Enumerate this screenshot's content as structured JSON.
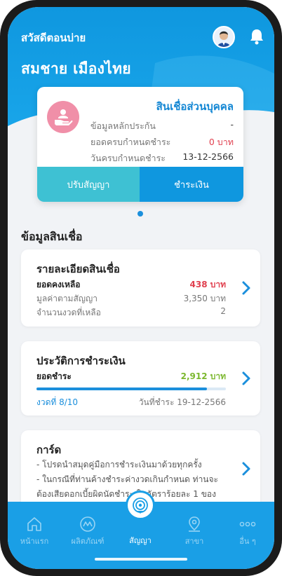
{
  "header": {
    "greeting": "สวัสดีตอนบ่าย",
    "user_name": "สมชาย เมืองไทย"
  },
  "loan_card": {
    "type": "สินเชื่อส่วนบุคคล",
    "rows": [
      {
        "label": "ข้อมูลหลักประกัน",
        "value": "-"
      },
      {
        "label": "ยอดครบกำหนดชำระ",
        "value": "0 บาท"
      },
      {
        "label": "วันครบกำหนดชำระ",
        "value": "13-12-2566"
      }
    ],
    "adjust_label": "ปรับสัญญา",
    "pay_label": "ชำระเงิน"
  },
  "section_title": "ข้อมูลสินเชื่อ",
  "loan_details": {
    "title": "รายละเอียดสินเชื่อ",
    "rows": [
      {
        "label": "ยอดคงเหลือ",
        "value": "438 บาท"
      },
      {
        "label": "มูลค่าตามสัญญา",
        "value": "3,350 บาท"
      },
      {
        "label": "จำนวนงวดที่เหลือ",
        "value": "2"
      }
    ]
  },
  "payment_history": {
    "title": "ประวัติการชำระเงิน",
    "paid_label": "ยอดชำระ",
    "paid_value": "2,912 บาท",
    "progress": 0.9,
    "installment": "งวดที่ 8/10",
    "pay_date": "วันที่ชำระ 19-12-2566"
  },
  "card_section": {
    "title": "การ์ด",
    "lines": [
      "- โปรดนำสมุดคู่มือการชำระเงินมาด้วยทุกครั้ง",
      "- ในกรณีที่ท่านค้างชำระค่างวดเกินกำหนด ท่านจะ",
      "ต้องเสียดอกเบี้ยผิดนัดชำระ ในอัตราร้อยละ 1 ของ"
    ]
  },
  "nav": {
    "items": [
      {
        "label": "หน้าแรก",
        "icon": "home-icon"
      },
      {
        "label": "ผลิตภัณฑ์",
        "icon": "products-icon"
      },
      {
        "label": "สัญญา",
        "icon": "contract-icon"
      },
      {
        "label": "สาขา",
        "icon": "branch-location-icon"
      },
      {
        "label": "อื่น ๆ",
        "icon": "more-icon"
      }
    ]
  },
  "colors": {
    "primary": "#1a9fe6",
    "accent_teal": "#3ec1d3",
    "alert_red": "#e0404f",
    "success_green": "#7cb82f",
    "loan_icon_pink": "#f08fa8"
  }
}
